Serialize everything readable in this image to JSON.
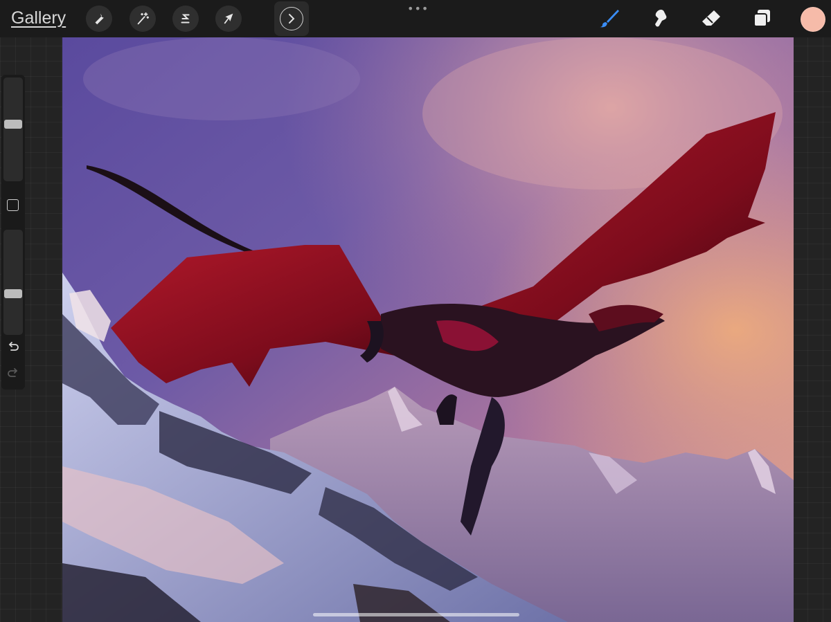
{
  "app": {
    "gallery_label": "Gallery",
    "more_dots": "•••"
  },
  "toolbar_left": {
    "tools": [
      {
        "name": "actions",
        "icon": "wrench-icon"
      },
      {
        "name": "adjustments",
        "icon": "magic-wand-icon"
      },
      {
        "name": "selection",
        "icon": "selection-s-icon"
      },
      {
        "name": "transform",
        "icon": "arrow-cursor-icon"
      }
    ],
    "sidebar_toggle_icon": "chevron-right-icon"
  },
  "toolbar_right": {
    "tools": [
      {
        "name": "brush",
        "icon": "brush-icon",
        "active": true
      },
      {
        "name": "smudge",
        "icon": "smudge-icon",
        "active": false
      },
      {
        "name": "eraser",
        "icon": "eraser-icon",
        "active": false
      },
      {
        "name": "layers",
        "icon": "layers-icon",
        "active": false
      }
    ],
    "current_color": "#F6BBA9",
    "active_tool_color": "#3A8DF6"
  },
  "sidebar": {
    "brush_size_level": 0.56,
    "opacity_level": 0.38,
    "modify_icon": "square-icon",
    "undo_icon": "undo-icon",
    "redo_icon": "redo-icon"
  },
  "canvas": {
    "artwork": "red-dragon-over-snowy-mountains-at-sunset"
  }
}
